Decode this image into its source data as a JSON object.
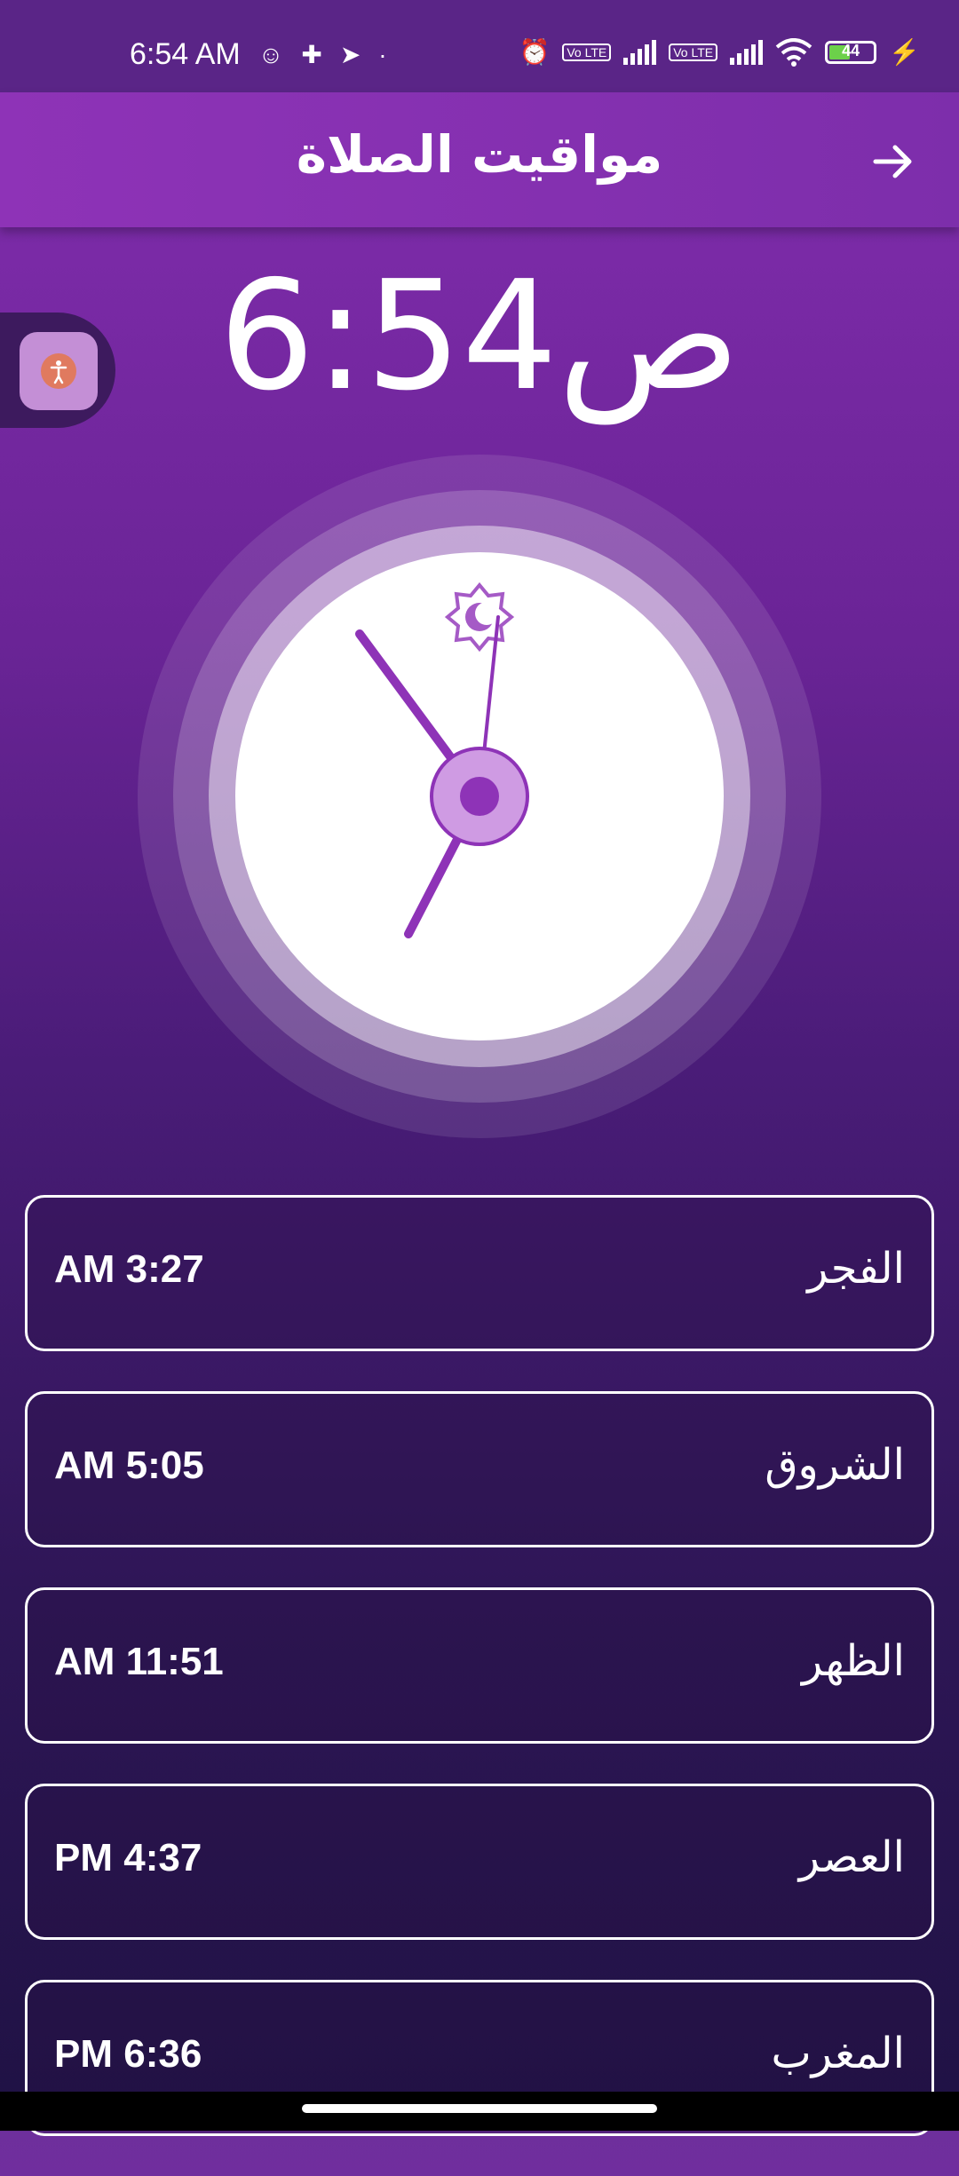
{
  "status_bar": {
    "time": "6:54 AM",
    "battery": "44",
    "icons": [
      "alarm-icon",
      "volte-icon",
      "signal-icon",
      "volte-icon",
      "signal-icon",
      "wifi-icon",
      "battery-icon",
      "charging-icon"
    ],
    "volte_label": "Vo LTE"
  },
  "app_bar": {
    "title": "مواقيت الصلاة",
    "back_icon": "arrow-right-icon"
  },
  "current_time": "6:54ص",
  "clock": {
    "marker_icon": "sun-moon-icon",
    "colors": {
      "accent": "#8e33b7",
      "hub": "#cf9be3",
      "face": "#ffffff"
    }
  },
  "prayers": [
    {
      "name": "الفجر",
      "time": "AM 3:27"
    },
    {
      "name": "الشروق",
      "time": "AM 5:05"
    },
    {
      "name": "الظهر",
      "time": "AM 11:51"
    },
    {
      "name": "العصر",
      "time": "PM 4:37"
    },
    {
      "name": "المغرب",
      "time": "PM 6:36"
    }
  ]
}
